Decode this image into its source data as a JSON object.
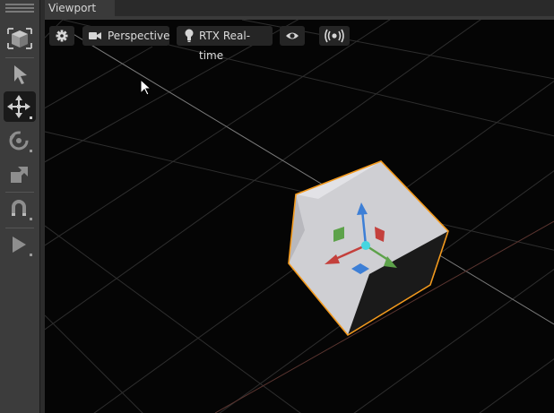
{
  "viewport_tab": {
    "label": "Viewport"
  },
  "viewport_toolbar": {
    "settings_icon": "gear-icon",
    "camera": {
      "icon": "video-camera-icon",
      "label": "Perspective"
    },
    "renderer": {
      "icon": "lightbulb-icon",
      "label": "RTX Real-time"
    },
    "visibility_icon": "eye-icon",
    "broadcast_icon": "broadcast-icon"
  },
  "left_toolbar": {
    "tools": [
      {
        "name": "frame-cube-icon",
        "active": false
      },
      {
        "name": "select-arrow-icon",
        "active": false
      },
      {
        "name": "move-icon",
        "active": true
      },
      {
        "name": "rotate-icon",
        "active": false
      },
      {
        "name": "scale-icon",
        "active": false
      },
      {
        "name": "snap-magnet-icon",
        "active": false
      },
      {
        "name": "play-icon",
        "active": false
      }
    ]
  },
  "colors": {
    "selection_outline": "#f39a1e",
    "gizmo_x": "#c4403c",
    "gizmo_y": "#3d7fd6",
    "gizmo_z": "#5da24a",
    "gizmo_center": "#46d6e0"
  }
}
